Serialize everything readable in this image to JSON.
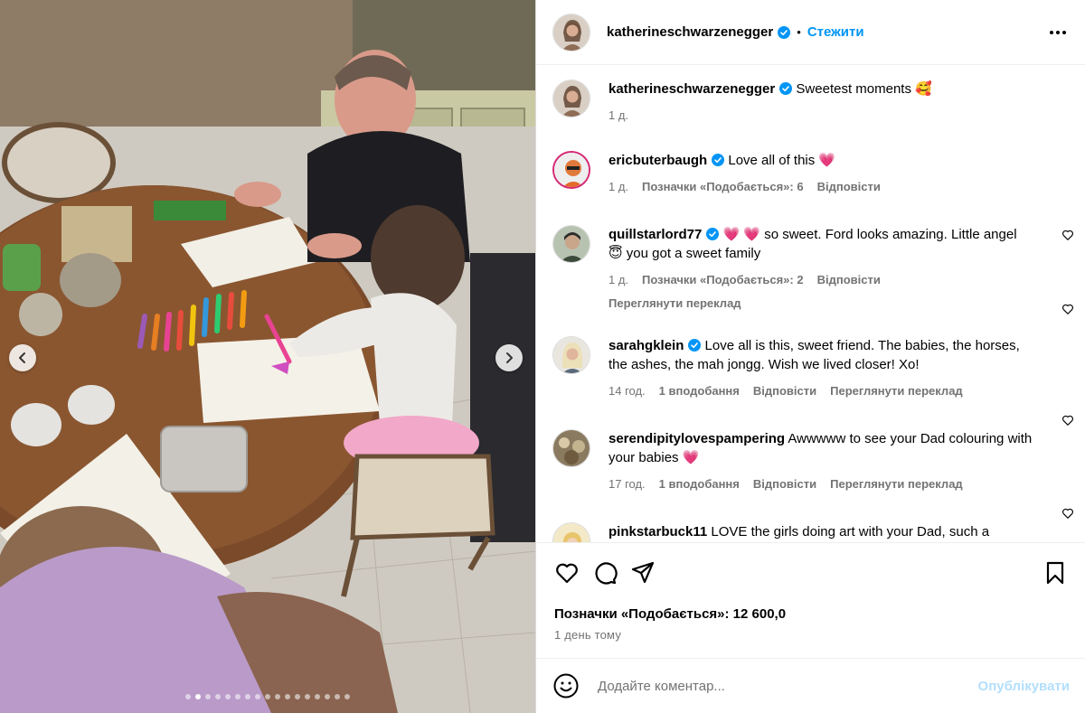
{
  "post": {
    "author": "katherineschwarzenegger",
    "follow_label": "Стежити",
    "bullet": "•",
    "caption": "Sweetest moments 🥰",
    "caption_time": "1 д.",
    "likes": "Позначки «Подобається»: 12 600,0",
    "posted": "1 день тому"
  },
  "comments": [
    {
      "username": "ericbuterbaugh",
      "verified": true,
      "text": "Love all of this 💗",
      "time": "1 д.",
      "likes": "Позначки «Подобається»: 6",
      "reply": "Відповісти"
    },
    {
      "username": "quillstarlord77",
      "verified": true,
      "text": "💗 💗 so sweet. Ford looks amazing. Little angel 😇 you got a sweet family",
      "time": "1 д.",
      "likes": "Позначки «Подобається»: 2",
      "reply": "Відповісти",
      "translate": "Переглянути переклад"
    },
    {
      "username": "sarahgklein",
      "verified": true,
      "text": "Love all is this, sweet friend. The babies, the horses, the ashes, the mah jongg. Wish we lived closer! Xo!",
      "time": "14 год.",
      "likes": "1 вподобання",
      "reply": "Відповісти",
      "translate": "Переглянути переклад"
    },
    {
      "username": "serendipitylovespampering",
      "verified": false,
      "text": "Awwwww to see your Dad colouring with your babies 💗",
      "time": "17 год.",
      "likes": "1 вподобання",
      "reply": "Відповісти",
      "translate": "Переглянути переклад"
    },
    {
      "username": "pinkstarbuck11",
      "verified": false,
      "text": "LOVE the girls doing art with your Dad, such a"
    }
  ],
  "composer": {
    "placeholder": "Додайте коментар...",
    "publish_label": "Опублікувати"
  },
  "carousel": {
    "slide_count": 17,
    "current_slide": 2
  },
  "colors": {
    "accent": "#0095f6",
    "verified": "#0095f6",
    "muted": "#737373",
    "publish_disabled": "#b2dffc"
  }
}
